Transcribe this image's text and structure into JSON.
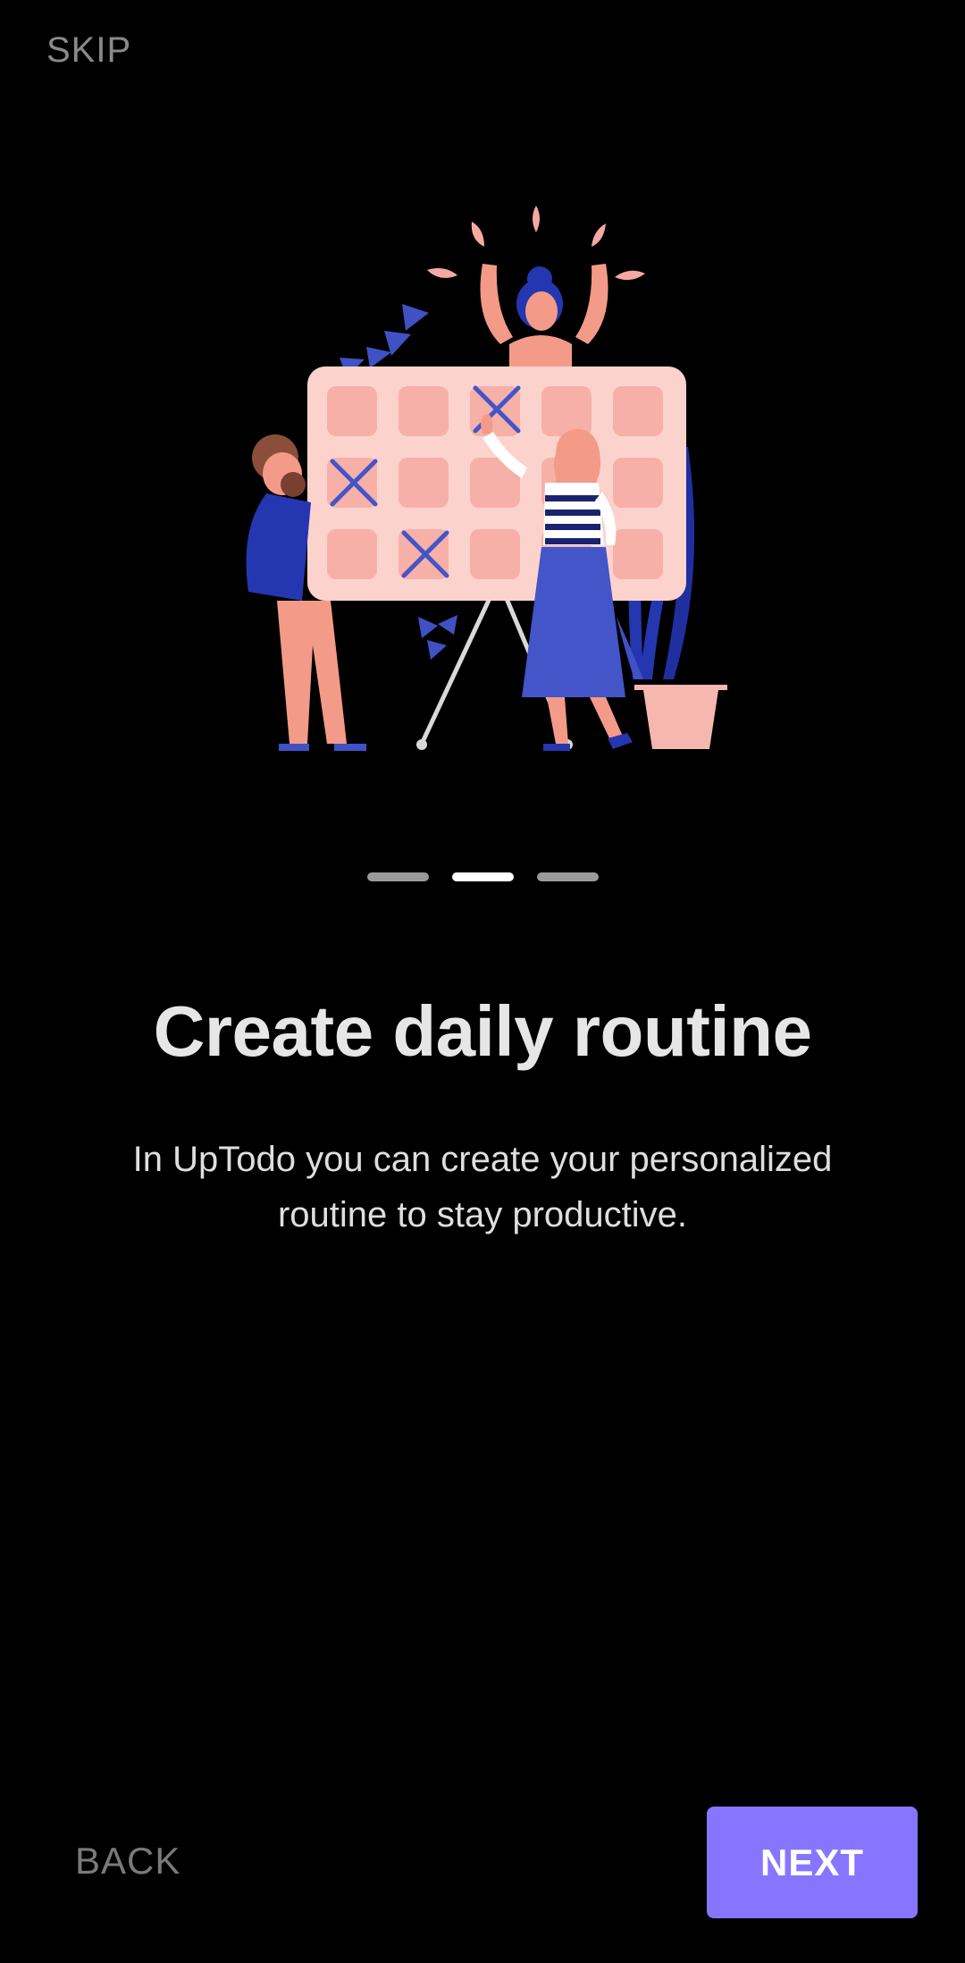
{
  "header": {
    "skip_label": "SKIP"
  },
  "illustration": {
    "icon": "daily-routine-calendar-illustration"
  },
  "pager": {
    "total": 3,
    "current": 2
  },
  "content": {
    "title": "Create daily routine",
    "description": "In UpTodo you can create your personalized routine to stay productive."
  },
  "footer": {
    "back_label": "BACK",
    "next_label": "NEXT"
  },
  "colors": {
    "background": "#000000",
    "accent": "#8875FF",
    "pager_active": "#FFFFFF",
    "pager_inactive": "#9A9A9A"
  }
}
